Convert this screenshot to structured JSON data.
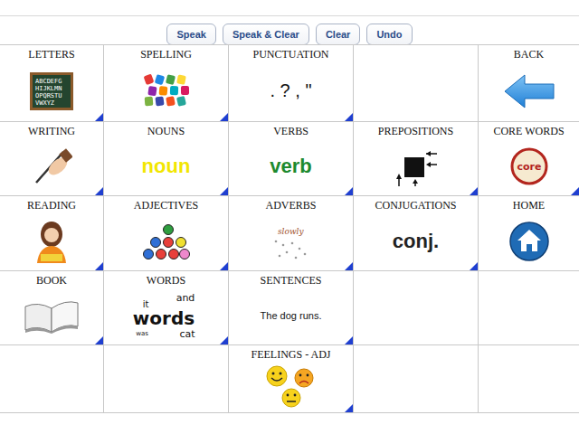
{
  "toolbar": {
    "buttons": [
      "Speak",
      "Speak & Clear",
      "Clear",
      "Undo"
    ]
  },
  "cells": [
    {
      "label": "LETTERS",
      "kind": "letters",
      "folder": true,
      "texts": [
        "ABCDEFG",
        "HIJKLMN",
        "OPQRSTU",
        "VWXYZ"
      ]
    },
    {
      "label": "SPELLING",
      "kind": "spelling",
      "folder": true
    },
    {
      "label": "PUNCTUATION",
      "kind": "punctuation",
      "folder": true,
      "texts": [
        ". ? , \""
      ]
    },
    {
      "label": "",
      "kind": "empty",
      "folder": false
    },
    {
      "label": "BACK",
      "kind": "back",
      "folder": false
    },
    {
      "label": "WRITING",
      "kind": "writing",
      "folder": true
    },
    {
      "label": "NOUNS",
      "kind": "word",
      "folder": true,
      "texts": [
        "noun"
      ],
      "color": "#f2e600"
    },
    {
      "label": "VERBS",
      "kind": "word",
      "folder": true,
      "texts": [
        "verb"
      ],
      "color": "#1e8a2e"
    },
    {
      "label": "PREPOSITIONS",
      "kind": "prepositions",
      "folder": true
    },
    {
      "label": "CORE WORDS",
      "kind": "core",
      "folder": true,
      "texts": [
        "core"
      ]
    },
    {
      "label": "READING",
      "kind": "reading",
      "folder": true
    },
    {
      "label": "ADJECTIVES",
      "kind": "adjectives",
      "folder": true
    },
    {
      "label": "ADVERBS",
      "kind": "adverbs",
      "folder": true,
      "texts": [
        "slowly"
      ]
    },
    {
      "label": "CONJUGATIONS",
      "kind": "word",
      "folder": true,
      "texts": [
        "conj."
      ],
      "color": "#222222"
    },
    {
      "label": "HOME",
      "kind": "home",
      "folder": false
    },
    {
      "label": "BOOK",
      "kind": "book",
      "folder": true
    },
    {
      "label": "WORDS",
      "kind": "words",
      "folder": true,
      "texts": [
        "and",
        "it",
        "words",
        "was",
        "cat"
      ]
    },
    {
      "label": "SENTENCES",
      "kind": "sentence",
      "folder": true,
      "texts": [
        "The dog runs."
      ]
    },
    {
      "label": "",
      "kind": "empty",
      "folder": false
    },
    {
      "label": "",
      "kind": "empty",
      "folder": false
    },
    {
      "label": "",
      "kind": "empty",
      "folder": false
    },
    {
      "label": "",
      "kind": "empty",
      "folder": false
    },
    {
      "label": "FEELINGS - ADJ",
      "kind": "feelings",
      "folder": true
    },
    {
      "label": "",
      "kind": "empty",
      "folder": false
    },
    {
      "label": "",
      "kind": "empty",
      "folder": false
    }
  ]
}
